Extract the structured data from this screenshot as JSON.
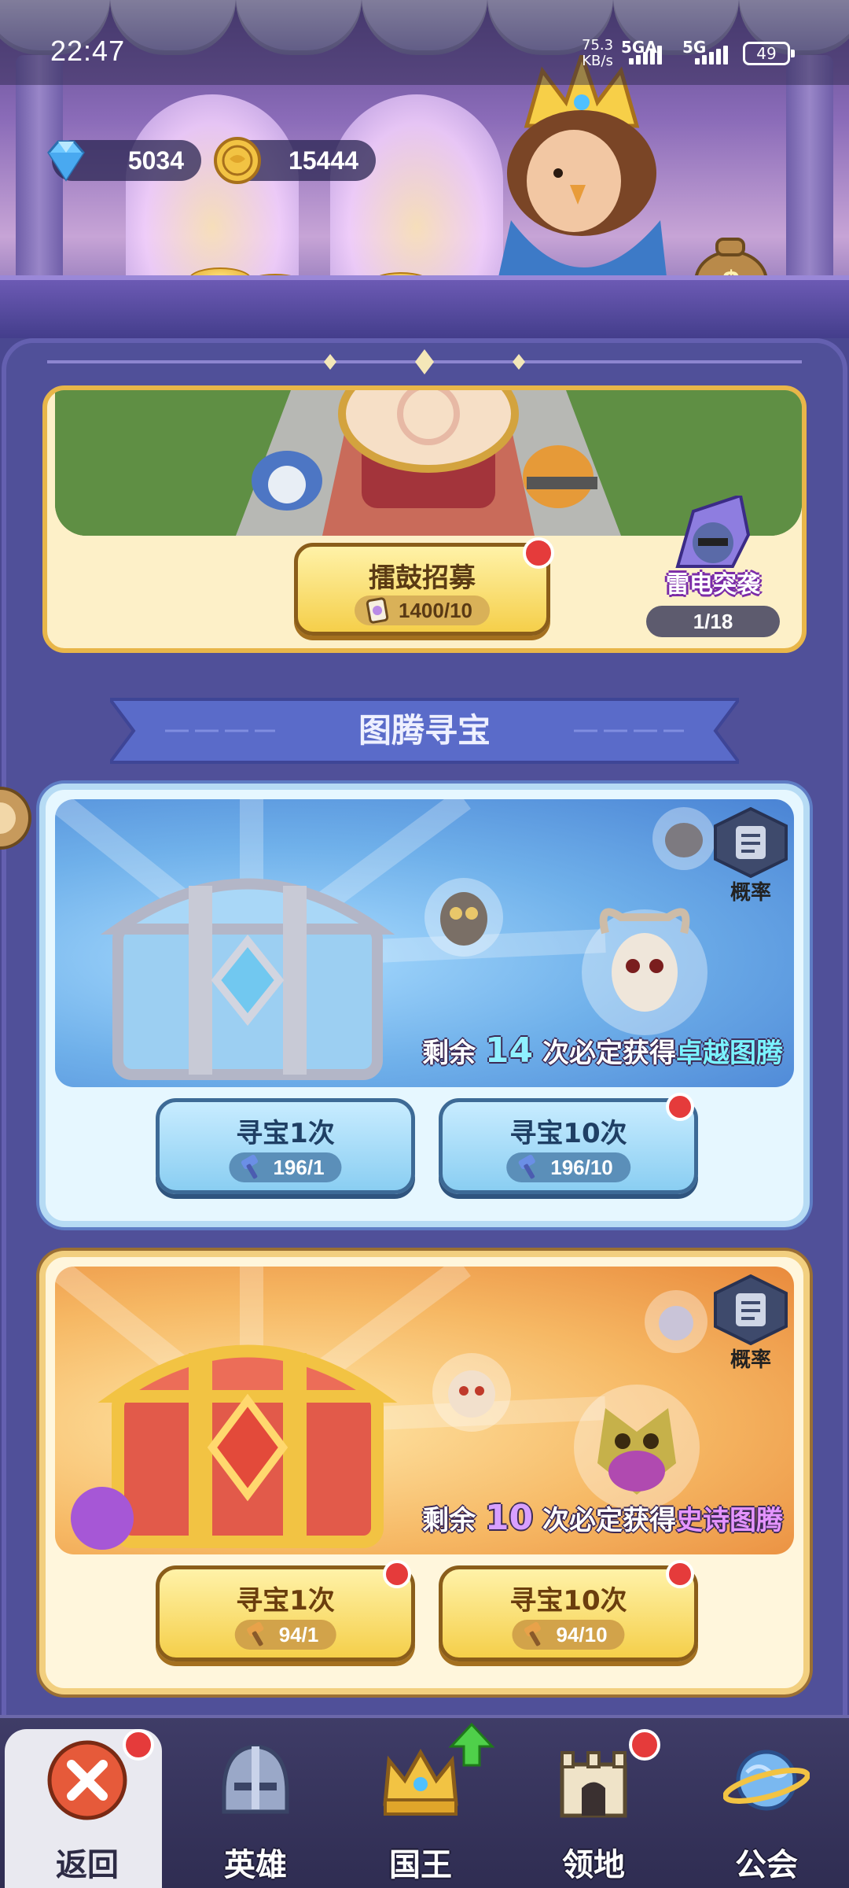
{
  "status_bar": {
    "time": "22:47",
    "net_speed_value": "75.3",
    "net_speed_unit": "KB/s",
    "signal_1": "5GA",
    "signal_2": "5G",
    "battery": "49"
  },
  "currencies": [
    {
      "name": "diamond-icon",
      "value": "5034",
      "color": "#6fc8ff"
    },
    {
      "name": "gold-coin-icon",
      "value": "15444",
      "color": "#f2b43a"
    }
  ],
  "drum_recruit": {
    "button_label": "擂鼓招募",
    "cost": "1400/10",
    "event_name": "雷电突袭",
    "event_progress": "1/18"
  },
  "section": {
    "title": "图腾寻宝"
  },
  "blue_treasure": {
    "probability_label": "概率",
    "guarantee_prefix": "剩余",
    "guarantee_count": "14",
    "guarantee_middle": "次必定获得",
    "guarantee_reward": "卓越图腾",
    "draw_1_label": "寻宝1次",
    "draw_1_cost": "196/1",
    "draw_10_label": "寻宝10次",
    "draw_10_cost": "196/10"
  },
  "gold_treasure": {
    "probability_label": "概率",
    "guarantee_prefix": "剩余",
    "guarantee_count": "10",
    "guarantee_middle": "次必定获得",
    "guarantee_reward": "史诗图腾",
    "draw_1_label": "寻宝1次",
    "draw_1_cost": "94/1",
    "draw_10_label": "寻宝10次",
    "draw_10_cost": "94/10"
  },
  "bottom_nav": [
    {
      "label": "返回",
      "icon": "close-icon"
    },
    {
      "label": "英雄",
      "icon": "helmet-icon"
    },
    {
      "label": "国王",
      "icon": "crown-icon"
    },
    {
      "label": "领地",
      "icon": "castle-icon"
    },
    {
      "label": "公会",
      "icon": "planet-icon"
    }
  ],
  "colors": {
    "notification_red": "#e53b3b",
    "panel_purple": "#4a4891",
    "gold_accent": "#f5cf4a",
    "blue_accent": "#8acef2"
  }
}
